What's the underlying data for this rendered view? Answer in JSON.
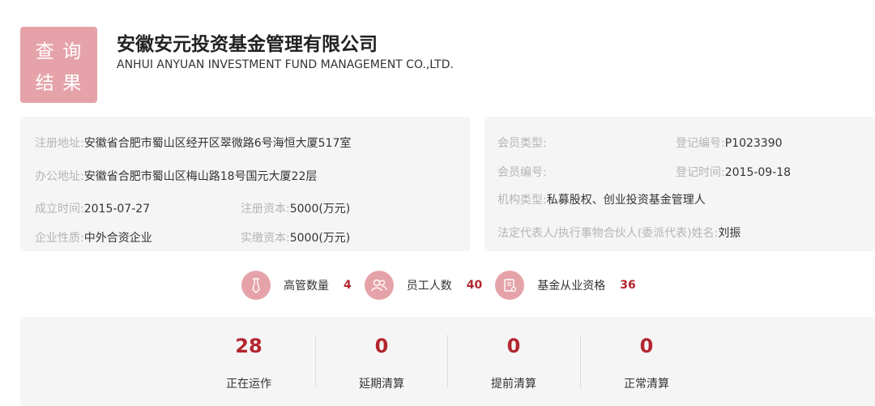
{
  "badge": {
    "chars": [
      "查",
      "询",
      "结",
      "果"
    ]
  },
  "company": {
    "name_cn": "安徽安元投资基金管理有限公司",
    "name_en": "ANHUI ANYUAN INVESTMENT FUND MANAGEMENT CO.,LTD."
  },
  "left_info": {
    "reg_address_label": "注册地址:",
    "reg_address_value": "安徽省合肥市蜀山区经开区翠微路6号海恒大厦517室",
    "office_address_label": "办公地址:",
    "office_address_value": "安徽省合肥市蜀山区梅山路18号国元大厦22层",
    "found_date_label": "成立时间:",
    "found_date_value": "2015-07-27",
    "reg_capital_label": "注册资本:",
    "reg_capital_value": "5000(万元)",
    "nature_label": "企业性质:",
    "nature_value": "中外合资企业",
    "paid_capital_label": "实缴资本:",
    "paid_capital_value": "5000(万元)"
  },
  "right_info": {
    "member_type_label": "会员类型:",
    "member_type_value": "",
    "reg_no_label": "登记编号:",
    "reg_no_value": "P1023390",
    "member_no_label": "会员编号:",
    "member_no_value": "",
    "reg_date_label": "登记时间:",
    "reg_date_value": "2015-09-18",
    "org_type_label": "机构类型:",
    "org_type_value": "私募股权、创业投资基金管理人",
    "legal_rep_label": "法定代表人/执行事物合伙人(委派代表)姓名:",
    "legal_rep_value": "刘振"
  },
  "stats": {
    "executives_label": "高管数量",
    "executives_value": "4",
    "employees_label": "员工人数",
    "employees_value": "40",
    "qualified_label": "基金从业资格",
    "qualified_value": "36"
  },
  "fund_status": [
    {
      "count": "28",
      "label": "正在运作"
    },
    {
      "count": "0",
      "label": "延期清算"
    },
    {
      "count": "0",
      "label": "提前清算"
    },
    {
      "count": "0",
      "label": "正常清算"
    }
  ],
  "colors": {
    "accent_pink": "#e5a3a9",
    "value_red": "#b3262f",
    "panel_bg": "#f5f5f5"
  },
  "icons": [
    "tie-icon",
    "people-icon",
    "certificate-icon"
  ]
}
